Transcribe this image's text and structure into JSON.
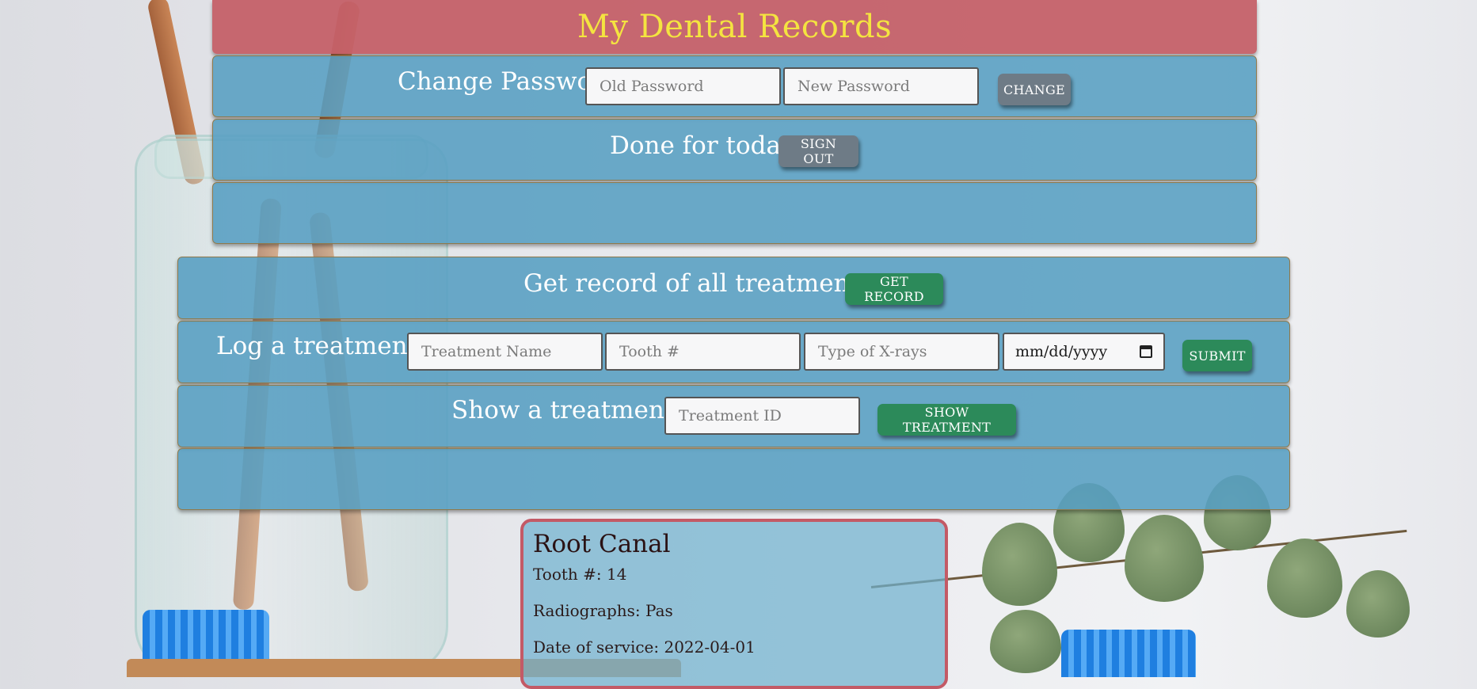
{
  "header": {
    "title": "My Dental Records"
  },
  "change_password": {
    "label": "Change Password",
    "old_placeholder": "Old Password",
    "new_placeholder": "New Password",
    "button_label": "CHANGE"
  },
  "sign_out": {
    "label": "Done for today?",
    "button_label": "SIGN OUT"
  },
  "get_record": {
    "label": "Get record of all treatments",
    "button_label": "GET RECORD"
  },
  "log_treatment": {
    "label": "Log a treatment",
    "name_placeholder": "Treatment Name",
    "tooth_placeholder": "Tooth #",
    "xray_placeholder": "Type of X-rays",
    "date_placeholder": "mm/dd/yyyy",
    "button_label": "SUBMIT"
  },
  "show_treatment": {
    "label": "Show a treatment",
    "id_placeholder": "Treatment ID",
    "button_label": "SHOW TREATMENT"
  },
  "treatment_card": {
    "title": "Root Canal",
    "tooth_label": "Tooth #:",
    "tooth_value": "14",
    "radiographs_label": "Radiographs:",
    "radiographs_value": "Pas",
    "date_label": "Date of service:",
    "date_value": "2022-04-01"
  },
  "colors": {
    "header_bg": "#c46068",
    "header_text": "#f4e440",
    "panel_bg": "#569ec2",
    "button_gray": "#6e7b86",
    "button_green": "#2c8a5a",
    "card_border": "#c35a66"
  }
}
